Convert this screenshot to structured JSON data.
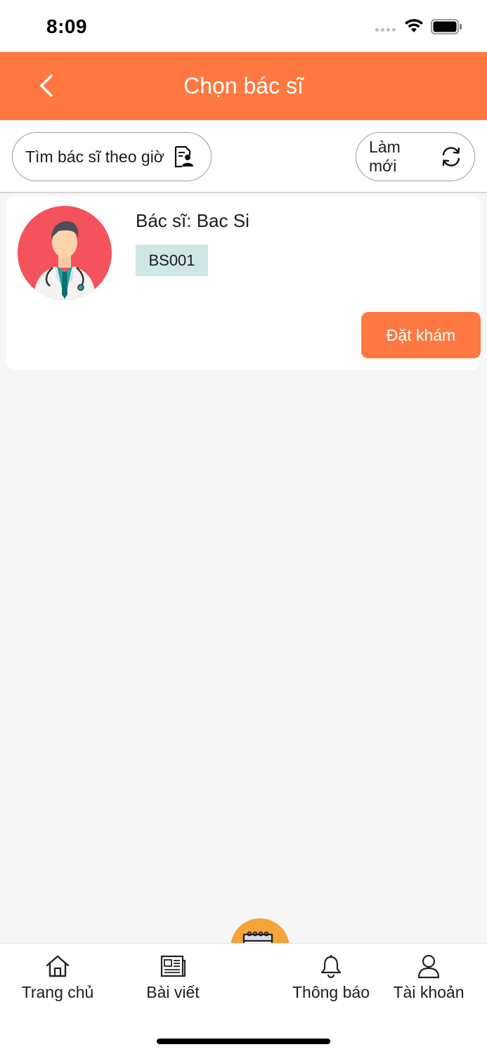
{
  "status_bar": {
    "time": "8:09"
  },
  "header": {
    "title": "Chọn bác sĩ"
  },
  "actions": {
    "find_by_time_label": "Tìm bác sĩ theo giờ",
    "refresh_label": "Làm mới"
  },
  "doctors": [
    {
      "name": "Bác sĩ: Bac Si",
      "code": "BS001",
      "book_label": "Đặt khám"
    }
  ],
  "bottom_nav": {
    "items": [
      {
        "label": "Trang chủ",
        "icon": "home-icon"
      },
      {
        "label": "Bài viết",
        "icon": "news-icon"
      },
      {
        "label": "",
        "icon": "calendar-add-icon"
      },
      {
        "label": "Thông báo",
        "icon": "bell-icon"
      },
      {
        "label": "Tài khoản",
        "icon": "user-icon"
      }
    ]
  },
  "colors": {
    "accent": "#ff7841",
    "fab": "#f6a33b",
    "avatar_bg": "#f4525c",
    "code_badge": "#cfe6e6"
  }
}
